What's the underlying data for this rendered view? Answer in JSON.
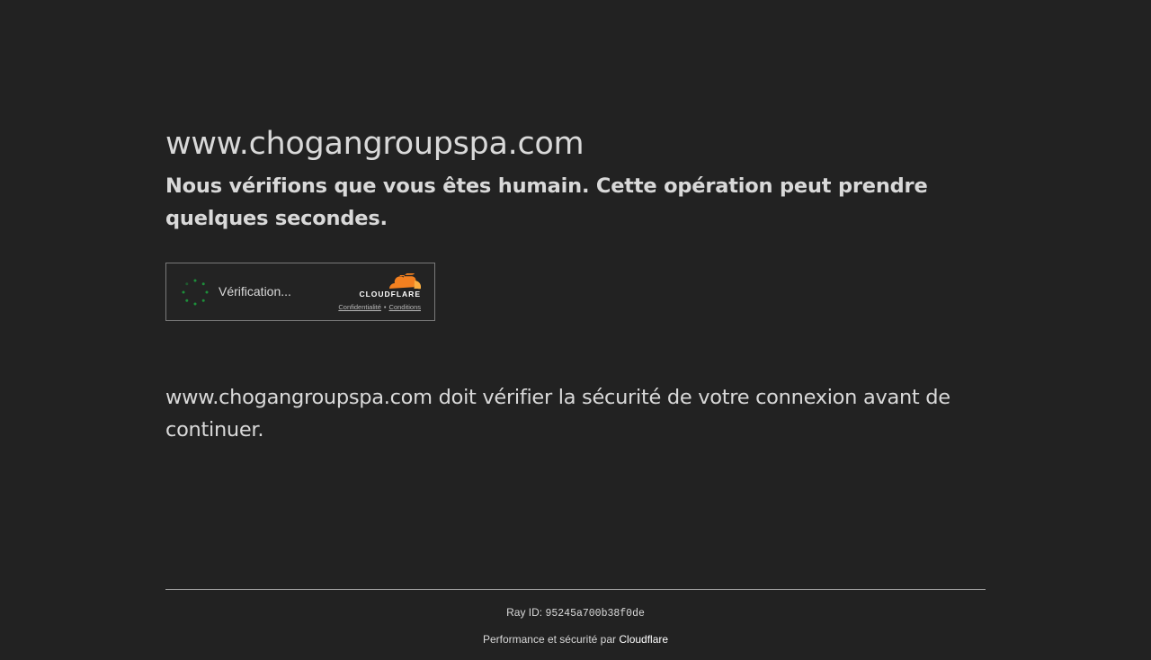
{
  "page": {
    "site_name": "www.chogangroupspa.com",
    "subtitle": "Nous vérifions que vous êtes humain. Cette opération peut prendre quelques secondes.",
    "explanation": "www.chogangroupspa.com doit vérifier la sécurité de votre connexion avant de continuer."
  },
  "widget": {
    "status_text": "Vérification...",
    "brand": "CLOUDFLARE",
    "privacy_link": "Confidentialité",
    "separator": "•",
    "terms_link": "Conditions",
    "spinner_color": "#1d8f3a",
    "logo_orange": "#f38020",
    "logo_light_orange": "#faae40"
  },
  "footer": {
    "ray_label": "Ray ID:",
    "ray_id": "95245a700b38f0de",
    "performance_text": "Performance et sécurité par",
    "cloudflare_link": "Cloudflare"
  },
  "colors": {
    "background": "#222222",
    "text": "#d9d9d9"
  }
}
